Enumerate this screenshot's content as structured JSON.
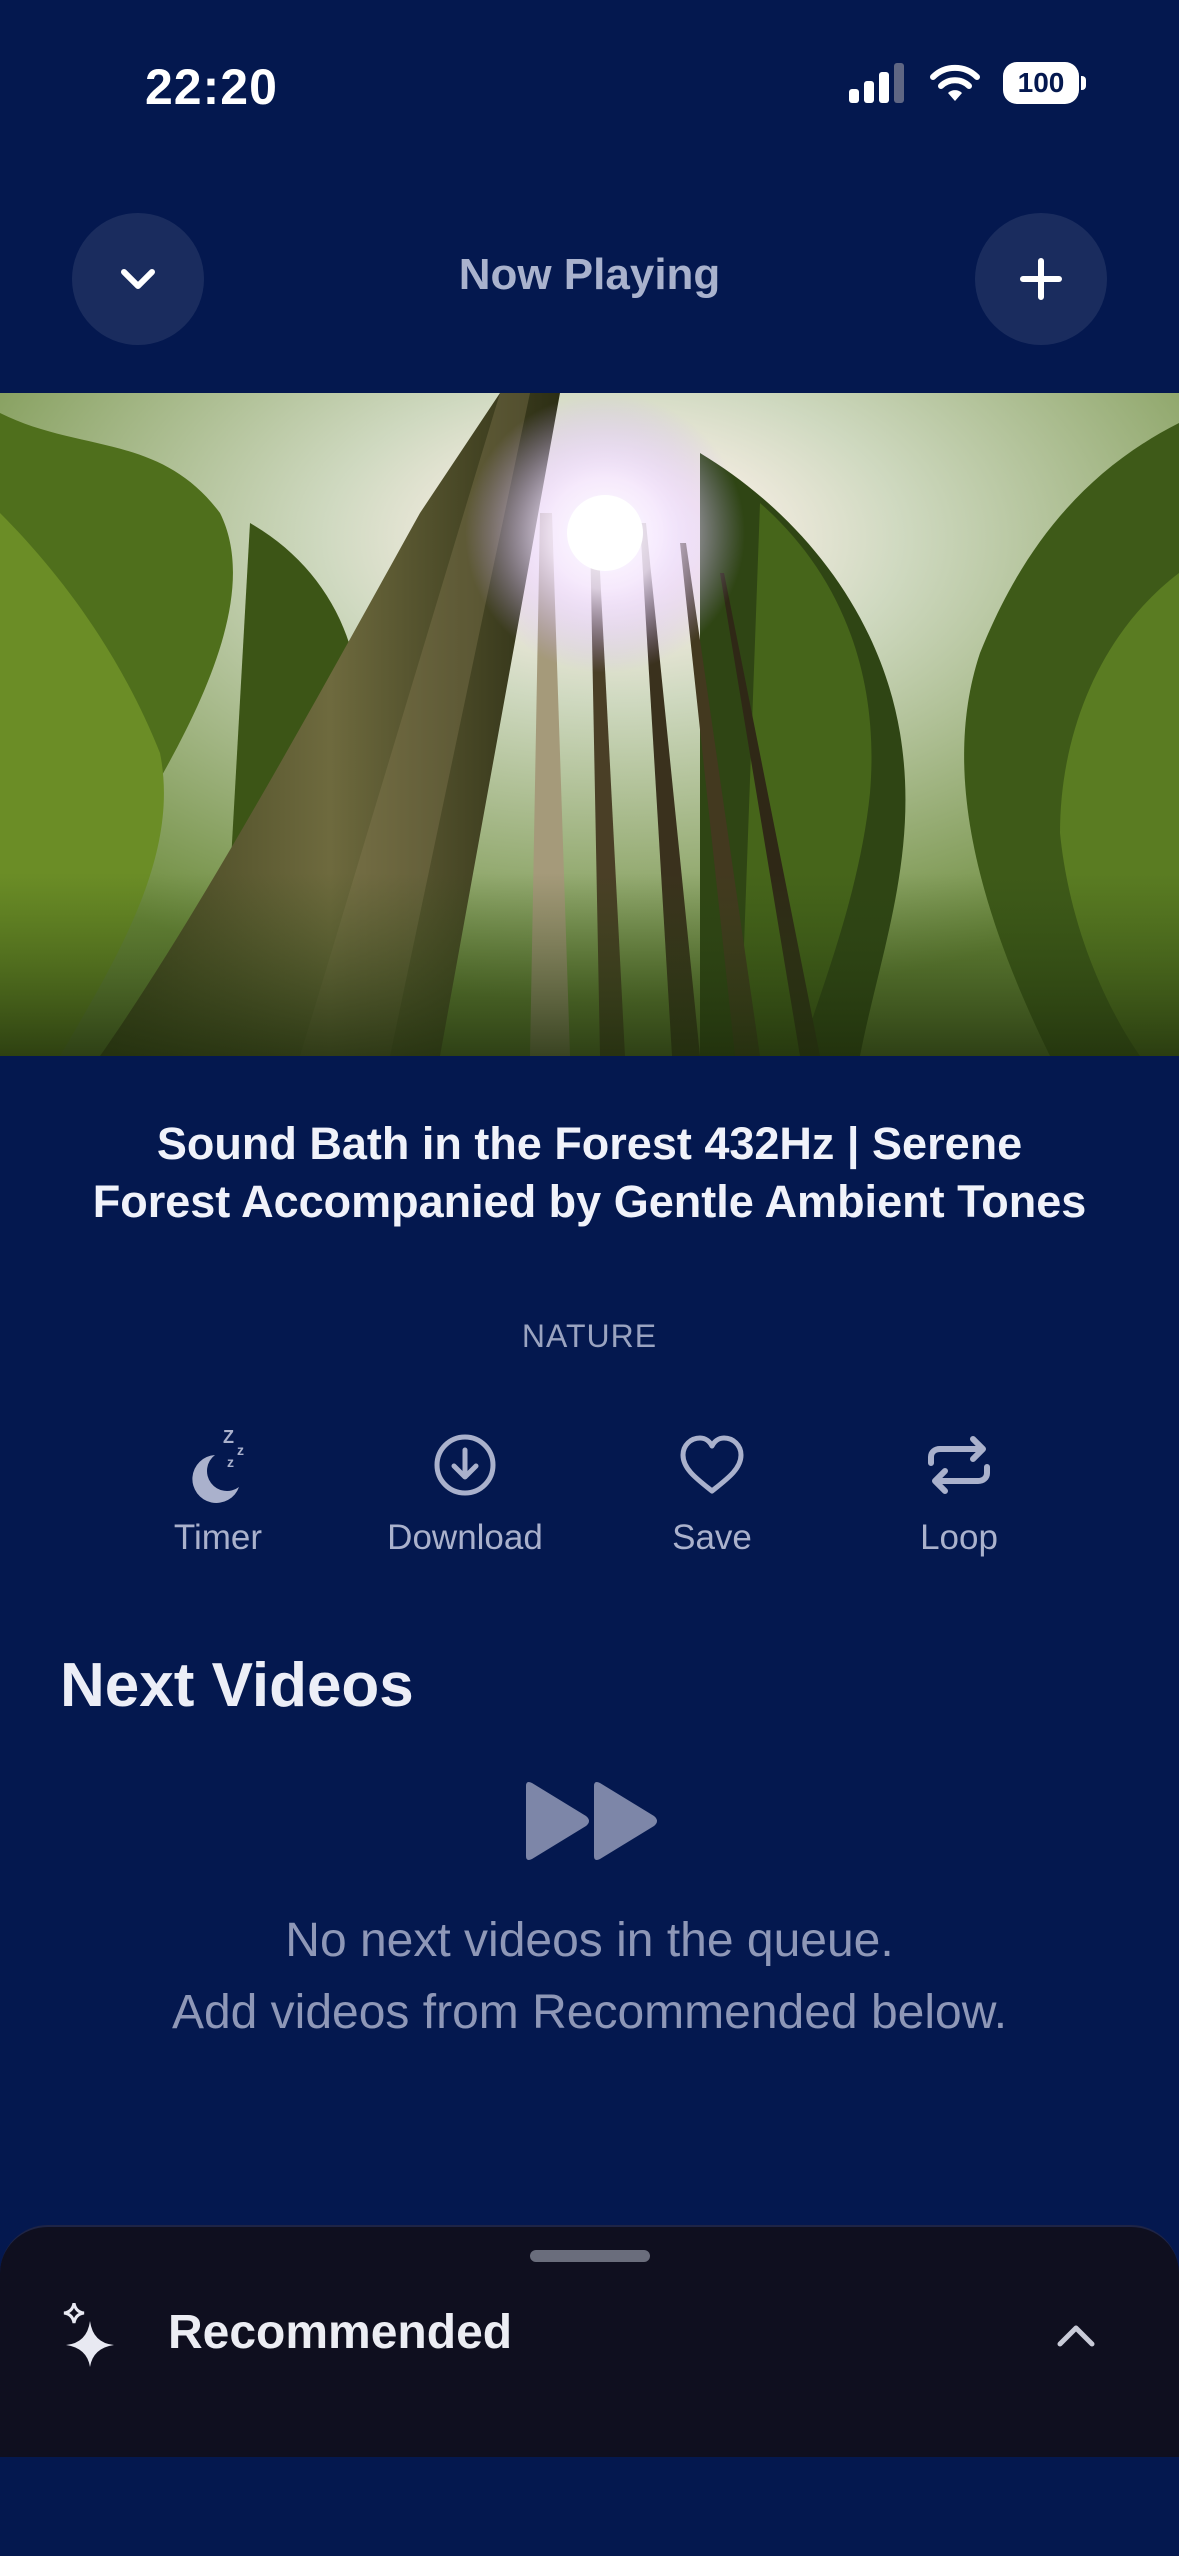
{
  "status_bar": {
    "time": "22:20",
    "battery": "100"
  },
  "header": {
    "title": "Now Playing"
  },
  "video": {
    "title": "Sound Bath in the Forest 432Hz | Serene Forest Accompanied by Gentle Ambient Tones",
    "category": "NATURE"
  },
  "actions": [
    {
      "label": "Timer",
      "icon": "timer-moon-icon"
    },
    {
      "label": "Download",
      "icon": "download-icon"
    },
    {
      "label": "Save",
      "icon": "heart-icon"
    },
    {
      "label": "Loop",
      "icon": "loop-icon"
    }
  ],
  "next_videos": {
    "title": "Next Videos",
    "empty_line1": "No next videos in the queue.",
    "empty_line2": "Add videos from Recommended below."
  },
  "recommended": {
    "label": "Recommended"
  },
  "colors": {
    "background": "#04184f",
    "sheet": "#0f0f1f",
    "muted_text": "#aab1cc"
  }
}
